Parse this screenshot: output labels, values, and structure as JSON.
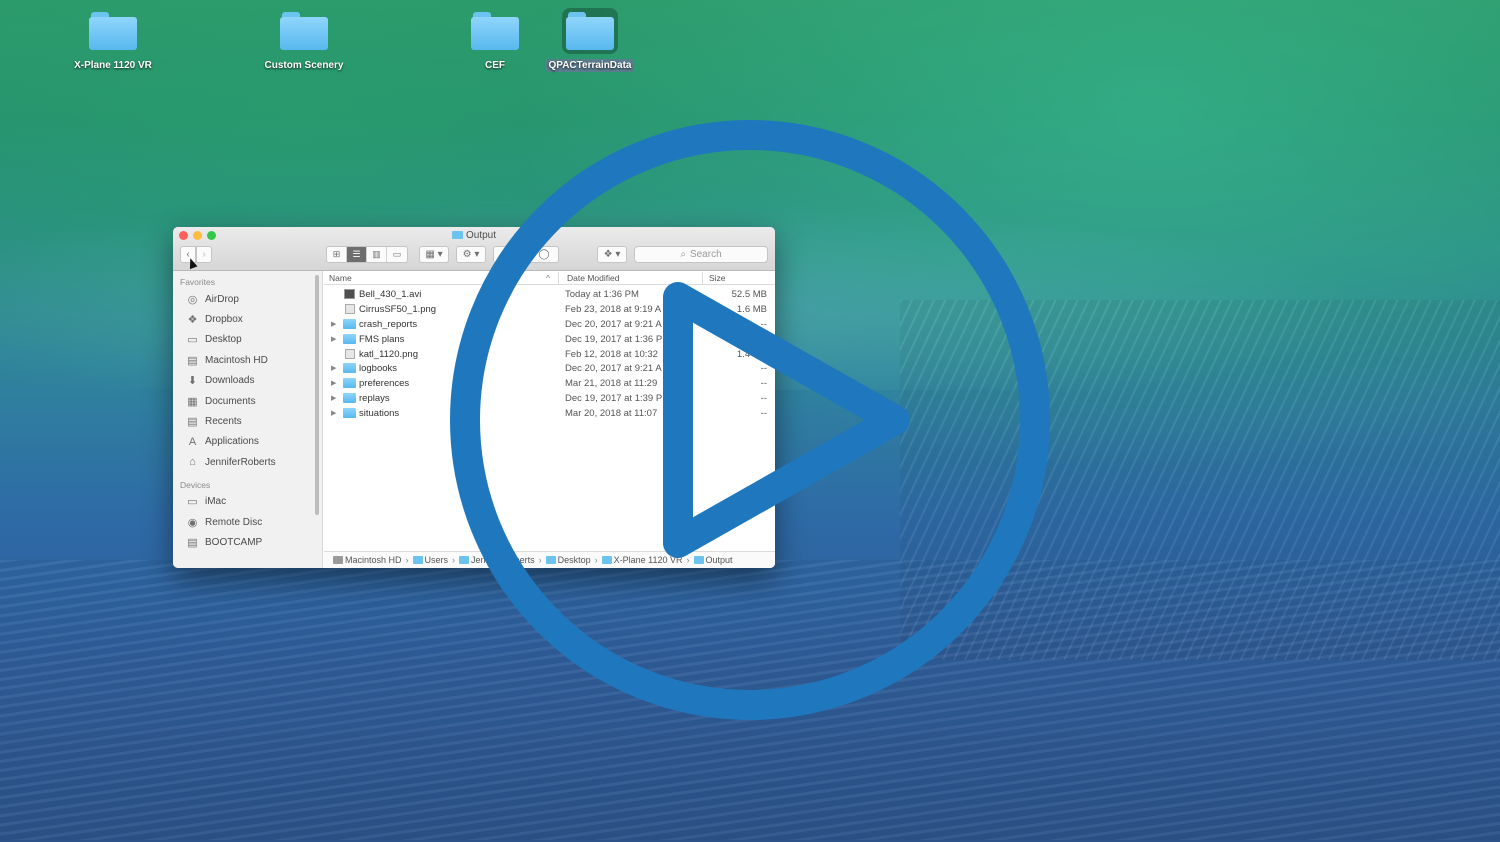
{
  "desktop": {
    "icons": [
      {
        "label": "X-Plane 1120 VR",
        "selected": false
      },
      {
        "label": "Custom Scenery",
        "selected": false
      },
      {
        "label": "CEF",
        "selected": false
      },
      {
        "label": "QPACTerrainData",
        "selected": true
      }
    ]
  },
  "finder": {
    "title": "Output",
    "search_placeholder": "Search",
    "nav_back": "‹",
    "nav_forward": "›",
    "sidebar": {
      "favorites_header": "Favorites",
      "favorites": [
        {
          "label": "AirDrop",
          "icon": "airdrop-icon",
          "glyph": "◎"
        },
        {
          "label": "Dropbox",
          "icon": "dropbox-icon",
          "glyph": "❖"
        },
        {
          "label": "Desktop",
          "icon": "desktop-icon",
          "glyph": "▭"
        },
        {
          "label": "Macintosh HD",
          "icon": "hard-drive-icon",
          "glyph": "▤"
        },
        {
          "label": "Downloads",
          "icon": "downloads-icon",
          "glyph": "⬇"
        },
        {
          "label": "Documents",
          "icon": "documents-icon",
          "glyph": "▦"
        },
        {
          "label": "Recents",
          "icon": "recents-icon",
          "glyph": "▤"
        },
        {
          "label": "Applications",
          "icon": "applications-icon",
          "glyph": "A"
        },
        {
          "label": "JenniferRoberts",
          "icon": "home-icon",
          "glyph": "⌂"
        }
      ],
      "devices_header": "Devices",
      "devices": [
        {
          "label": "iMac",
          "icon": "imac-icon",
          "glyph": "▭"
        },
        {
          "label": "Remote Disc",
          "icon": "remote-disc-icon",
          "glyph": "◉"
        },
        {
          "label": "BOOTCAMP",
          "icon": "drive-icon",
          "glyph": "▤"
        }
      ]
    },
    "columns": {
      "name": "Name",
      "date": "Date Modified",
      "size": "Size"
    },
    "files": [
      {
        "name": "Bell_430_1.avi",
        "date": "Today at 1:36 PM",
        "size": "52.5 MB",
        "kind": "file-dark",
        "expandable": false
      },
      {
        "name": "CirrusSF50_1.png",
        "date": "Feb 23, 2018 at 9:19 A",
        "size": "1.6 MB",
        "kind": "file-light",
        "expandable": false
      },
      {
        "name": "crash_reports",
        "date": "Dec 20, 2017 at 9:21 A",
        "size": "--",
        "kind": "folder",
        "expandable": true
      },
      {
        "name": "FMS plans",
        "date": "Dec 19, 2017 at 1:36 P",
        "size": "--",
        "kind": "folder",
        "expandable": true
      },
      {
        "name": "katl_1120.png",
        "date": "Feb 12, 2018 at 10:32",
        "size": "1.4 MB",
        "kind": "file-light",
        "expandable": false
      },
      {
        "name": "logbooks",
        "date": "Dec 20, 2017 at 9:21 A",
        "size": "--",
        "kind": "folder",
        "expandable": true
      },
      {
        "name": "preferences",
        "date": "Mar 21, 2018 at 11:29",
        "size": "--",
        "kind": "folder",
        "expandable": true
      },
      {
        "name": "replays",
        "date": "Dec 19, 2017 at 1:39 P",
        "size": "--",
        "kind": "folder",
        "expandable": true
      },
      {
        "name": "situations",
        "date": "Mar 20, 2018 at 11:07",
        "size": "--",
        "kind": "folder",
        "expandable": true
      }
    ],
    "path": [
      "Macintosh HD",
      "Users",
      "JenniferRoberts",
      "Desktop",
      "X-Plane 1120 VR",
      "Output"
    ]
  },
  "overlay": {
    "icon": "play-icon",
    "color": "#1f78bd"
  }
}
